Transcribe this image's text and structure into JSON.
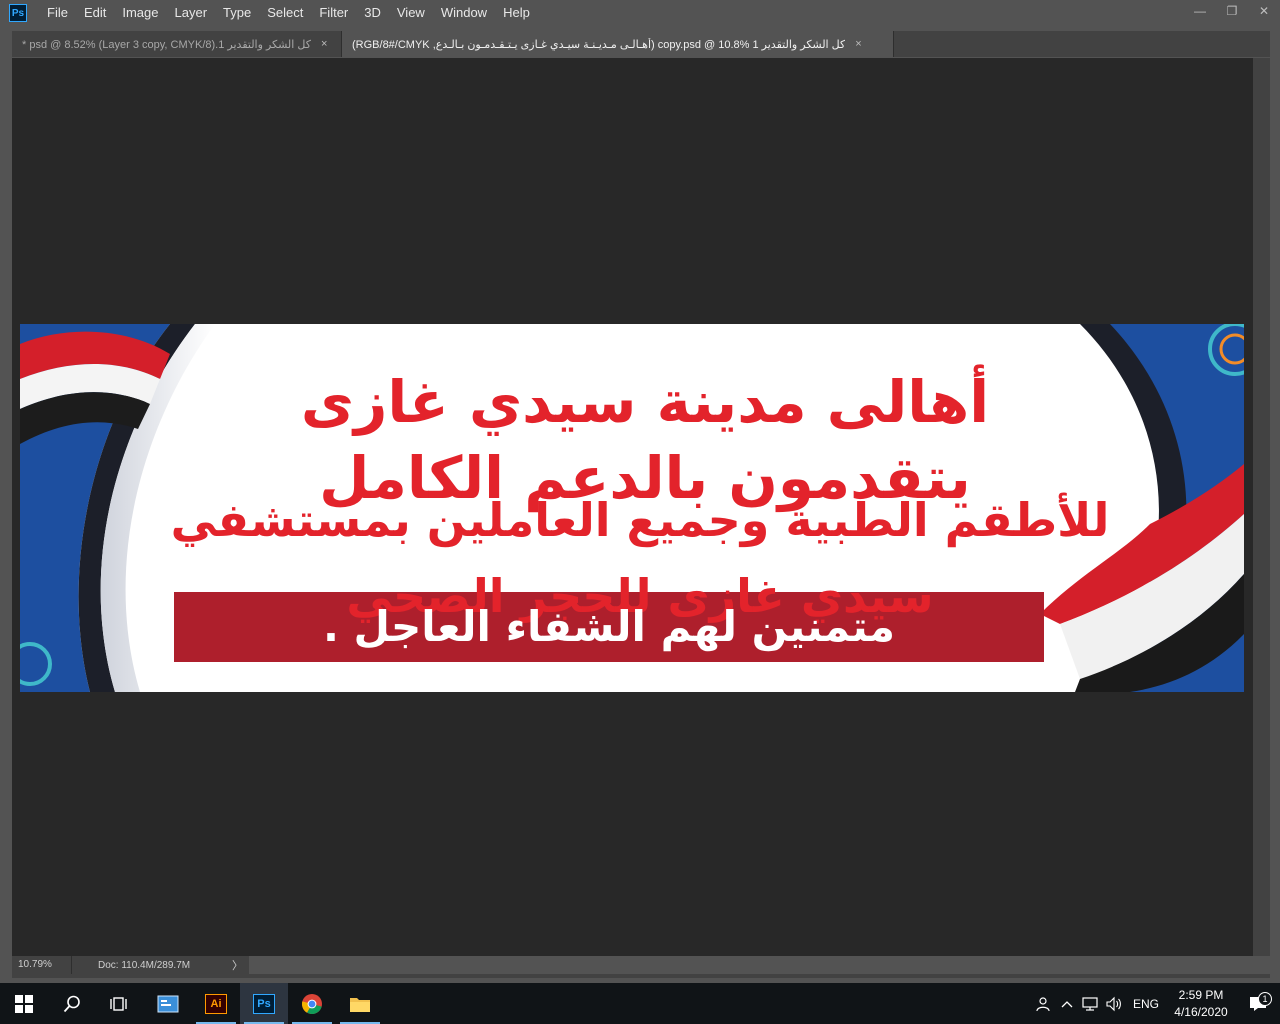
{
  "menubar": {
    "logo": "Ps",
    "items": [
      "File",
      "Edit",
      "Image",
      "Layer",
      "Type",
      "Select",
      "Filter",
      "3D",
      "View",
      "Window",
      "Help"
    ]
  },
  "window_controls": {
    "minimize": "—",
    "restore": "❐",
    "close": "✕"
  },
  "tabs": [
    {
      "label": "كل الشكر والتقدير 1.psd @ 8.52% (Layer 3 copy, CMYK/8) *",
      "close": "×"
    },
    {
      "label": "كل الشكر والتقدير 1 copy.psd @ 10.8% (أهـالـى مـديـنـة سيـدي غـازى يـتـقـدمـون بـالـدع, RGB/8#/CMYK)",
      "close": "×"
    }
  ],
  "banner": {
    "line1": "أهالى مدينة سيدي غازى يتقدمون بالدعم الكامل",
    "line2": "للأطقم الطبية وجميع العاملين بمستشفي سيدي غازى للحجر الصحي",
    "line3": "متمنين لهم الشفاء العاجل .",
    "colors": {
      "text_red": "#e3232b",
      "strip_red": "#ae1f2c",
      "blue": "#1d4fa0",
      "dark": "#1c1f29"
    }
  },
  "statusbar": {
    "zoom": "10.79%",
    "doc": "Doc: 110.4M/289.7M",
    "arrow": "〉"
  },
  "taskbar": {
    "lang": "ENG",
    "time": "2:59 PM",
    "date": "4/16/2020",
    "notification_count": "1",
    "illustrator_label": "Ai",
    "photoshop_label": "Ps"
  }
}
